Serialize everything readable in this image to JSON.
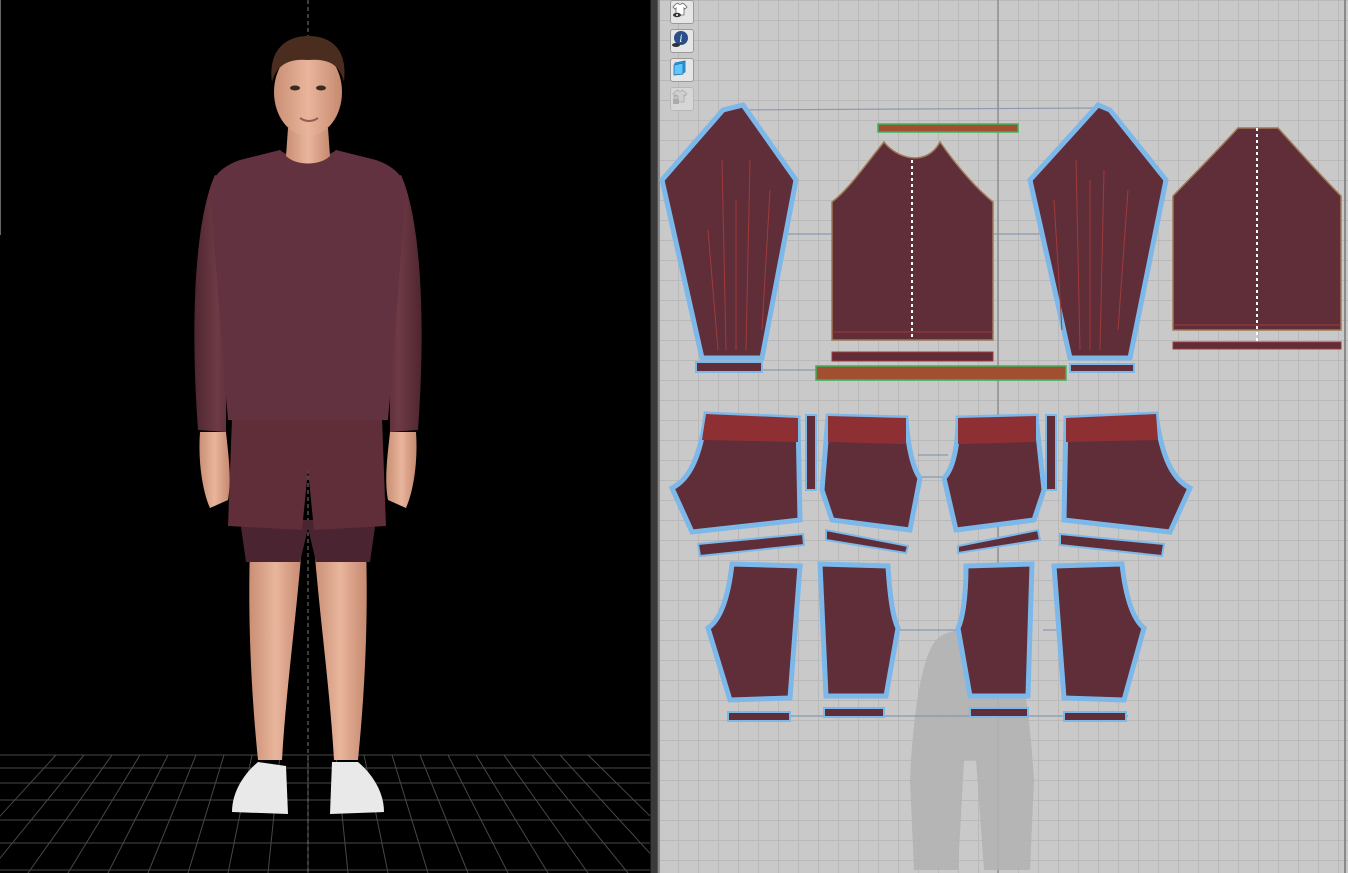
{
  "window": {
    "panels": [
      "3d-view",
      "2d-pattern-view"
    ]
  },
  "toolbar": {
    "tools": [
      {
        "name": "show-garment",
        "icon": "shirt-eye-icon",
        "enabled": true
      },
      {
        "name": "show-info",
        "icon": "info-icon",
        "enabled": true
      },
      {
        "name": "show-fabric",
        "icon": "fabric-icon",
        "enabled": true
      },
      {
        "name": "lock-garment",
        "icon": "shirt-lock-icon",
        "enabled": false
      }
    ]
  },
  "colors": {
    "fabric": "#5f2e39",
    "fabric_band": "#8e3033",
    "outline": "#7db8ea",
    "background_3d": "#000000",
    "background_2d": "#c9c9c9",
    "skin": "#d9a48b"
  }
}
